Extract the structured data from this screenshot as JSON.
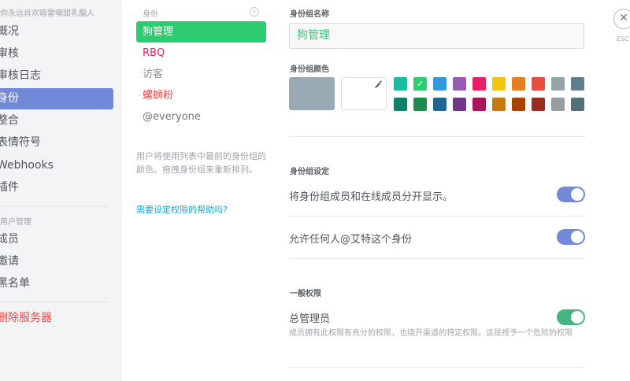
{
  "sidebar": {
    "header": "你永远肖欢暗雷嘲甜乳腦人",
    "items": [
      {
        "label": "概况"
      },
      {
        "label": "审核"
      },
      {
        "label": "审核日志"
      },
      {
        "label": "身份"
      },
      {
        "label": "整合"
      },
      {
        "label": "表情符号"
      },
      {
        "label": "Webhooks"
      },
      {
        "label": "插件"
      }
    ],
    "user_section": "用户管理",
    "user_items": [
      {
        "label": "成员"
      },
      {
        "label": "邀请"
      },
      {
        "label": "黑名单"
      }
    ],
    "delete_label": "删除服务器"
  },
  "roles": {
    "title": "身份",
    "add_icon": "plus-circle-icon",
    "items": [
      {
        "label": "狗管理",
        "color": "#ffffff"
      },
      {
        "label": "RBQ",
        "color": "#e91e63"
      },
      {
        "label": "访客",
        "color": "#8e9297"
      },
      {
        "label": "螺蛳粉",
        "color": "#f04747"
      },
      {
        "label": "@everyone",
        "color": "#72767d"
      }
    ],
    "help_text": "用户将使用列表中最前的身份组的颜色。拖拽身份组来重新排列。",
    "help_link": "需要设定权限的帮助吗?"
  },
  "main": {
    "name_label": "身份组名称",
    "name_value": "狗管理",
    "color_label": "身份组颜色",
    "selected_color": "#2ecc71",
    "default_color": "#99aab5",
    "picker_icon": "eyedropper-icon",
    "swatches_row1": [
      "#1abc9c",
      "#2ecc71",
      "#3498db",
      "#9b59b6",
      "#e91e63",
      "#f1c40f",
      "#e67e22",
      "#e74c3c",
      "#95a5a6",
      "#607d8b"
    ],
    "swatches_row2": [
      "#11806a",
      "#1f8b4c",
      "#206694",
      "#71368a",
      "#ad1457",
      "#c27c0e",
      "#a84300",
      "#992d22",
      "#979c9f",
      "#546e7a"
    ],
    "settings_label": "身份组设定",
    "settings": [
      {
        "text": "将身份组成员和在线成员分开显示。",
        "enabled": true
      },
      {
        "text": "允许任何人@艾特这个身份",
        "enabled": true
      }
    ],
    "general_label": "一般权限",
    "permissions": [
      {
        "title": "总管理员",
        "desc": "成员拥有此权限有充分的权限，也绕开渠道的特定权限。这是授予一个危险的权限",
        "enabled": true
      }
    ]
  },
  "close": {
    "icon": "close-icon",
    "esc": "ESC"
  }
}
